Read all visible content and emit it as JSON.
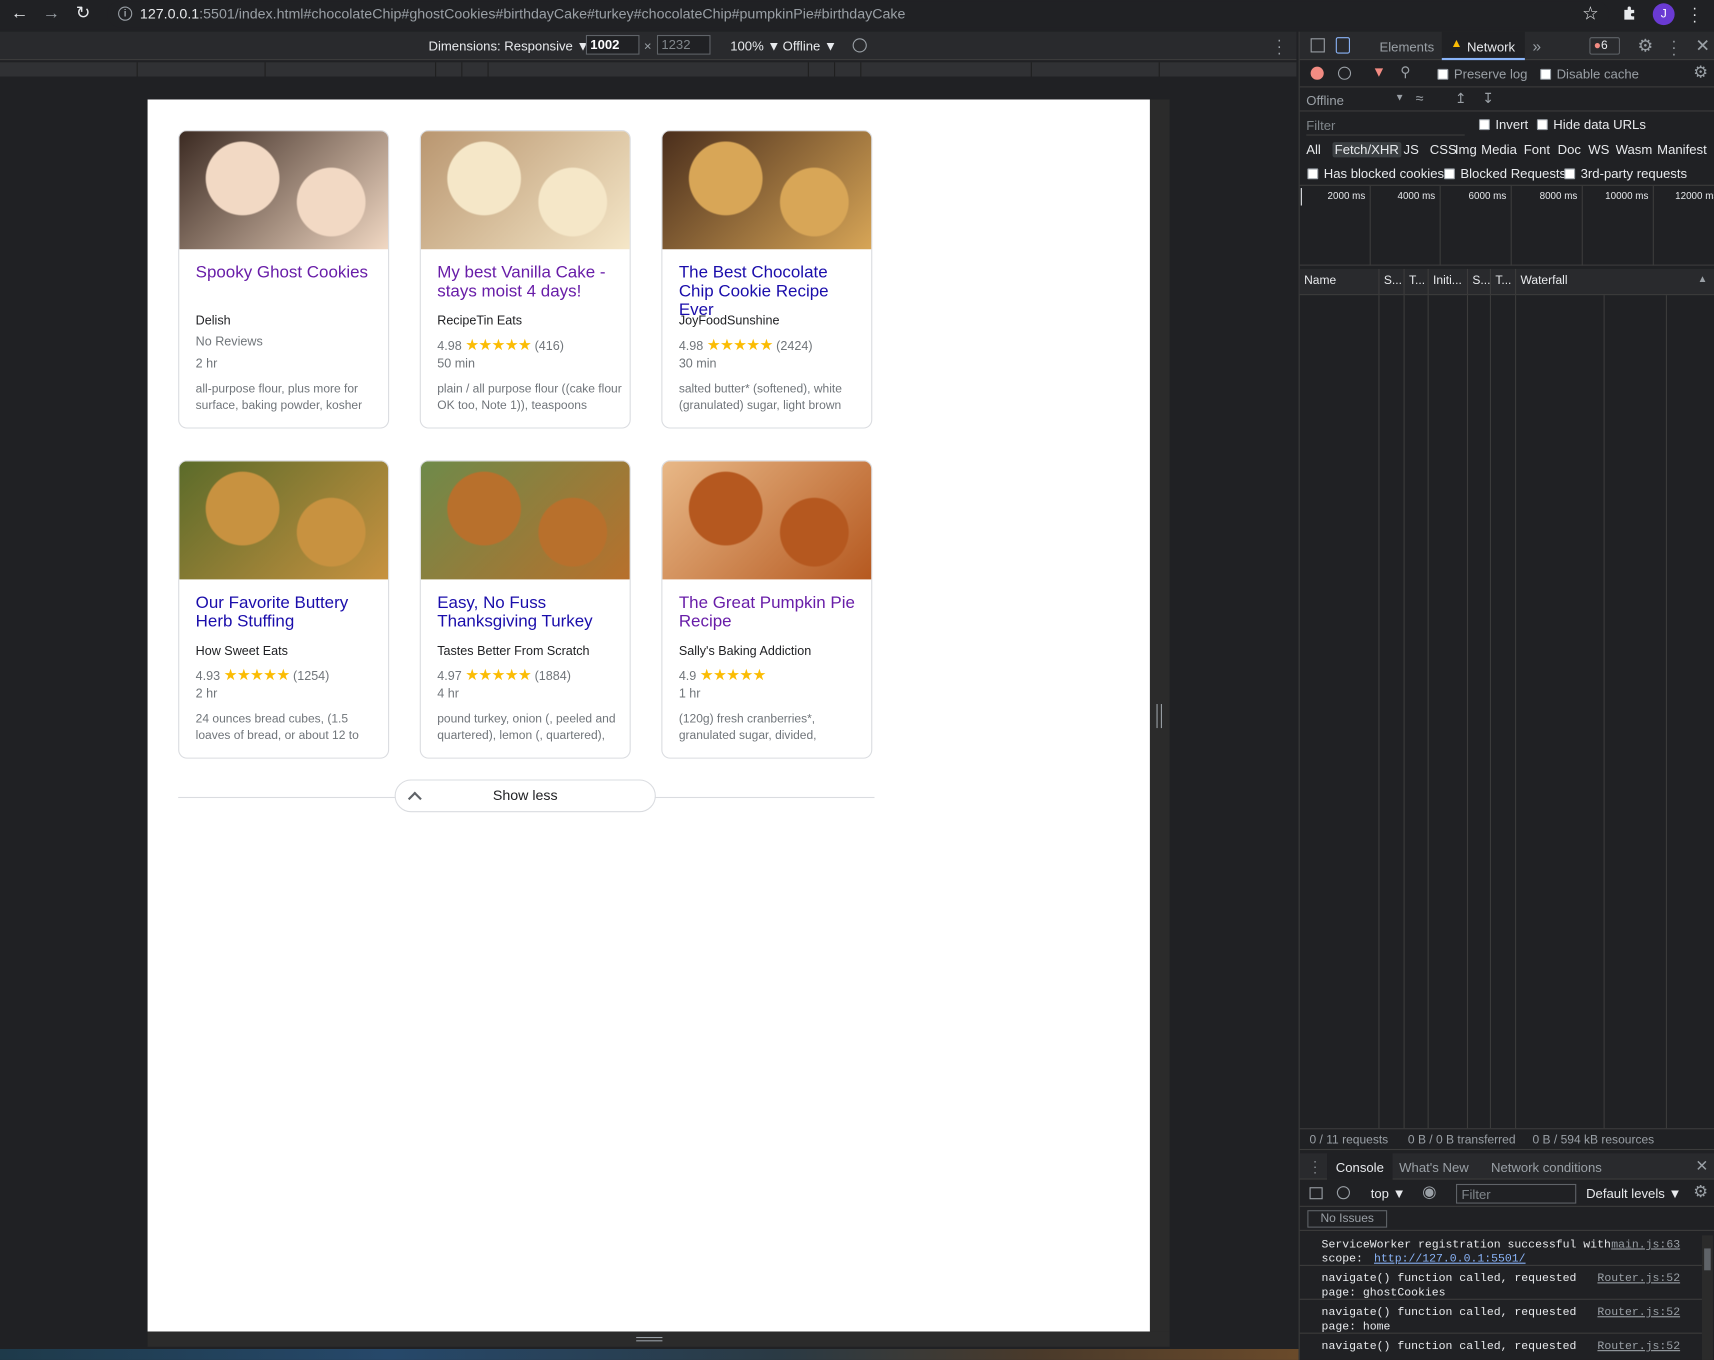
{
  "browser": {
    "url_host": "127.0.0.1",
    "url_rest": ":5501/index.html#chocolateChip#ghostCookies#birthdayCake#turkey#chocolateChip#pumpkinPie#birthdayCake",
    "avatar_letter": "J"
  },
  "device_toolbar": {
    "dimensions_label": "Dimensions: Responsive ▼",
    "width": "1002",
    "x": "×",
    "height": "1232",
    "zoom": "100% ▼",
    "throttle": "Offline ▼"
  },
  "recipes": [
    {
      "title": "Spooky Ghost Cookies",
      "visited": true,
      "source": "Delish",
      "rating": "No Reviews",
      "has_stars": false,
      "stars": "",
      "count": "",
      "time": "2 hr",
      "ingredients": "all-purpose flour, plus more for surface, baking powder, kosher",
      "img_colors": [
        "#f2d9c4",
        "#3b2a22"
      ]
    },
    {
      "title": "My best Vanilla Cake - stays moist 4 days!",
      "visited": true,
      "source": "RecipeTin Eats",
      "rating": "4.98",
      "has_stars": true,
      "stars": "★★★★★",
      "count": "(416)",
      "time": "50 min",
      "ingredients": "plain / all purpose flour ((cake flour OK too, Note 1)), teaspoons",
      "img_colors": [
        "#f5e7c8",
        "#b99670"
      ]
    },
    {
      "title": "The Best Chocolate Chip Cookie Recipe Ever",
      "visited": false,
      "source": "JoyFoodSunshine",
      "rating": "4.98",
      "has_stars": true,
      "stars": "★★★★★",
      "count": "(2424)",
      "time": "30 min",
      "ingredients": "salted butter* (softened), white (granulated) sugar, light brown",
      "img_colors": [
        "#d8a657",
        "#4a2e1c"
      ]
    },
    {
      "title": "Our Favorite Buttery Herb Stuffing",
      "visited": false,
      "source": "How Sweet Eats",
      "rating": "4.93",
      "has_stars": true,
      "stars": "★★★★★",
      "count": "(1254)",
      "time": "2 hr",
      "ingredients": "24 ounces bread cubes, (1.5 loaves of bread, or about 12 to",
      "img_colors": [
        "#c89240",
        "#5b6b2a"
      ]
    },
    {
      "title": "Easy, No Fuss Thanksgiving Turkey",
      "visited": false,
      "source": "Tastes Better From Scratch",
      "rating": "4.97",
      "has_stars": true,
      "stars": "★★★★★",
      "count": "(1884)",
      "time": "4 hr",
      "ingredients": "pound turkey, onion (, peeled and quartered), lemon (, quartered),",
      "img_colors": [
        "#b8702c",
        "#6e8a4a"
      ]
    },
    {
      "title": "The Great Pumpkin Pie Recipe",
      "visited": true,
      "source": "Sally's Baking Addiction",
      "rating": "4.9",
      "has_stars": true,
      "stars": "★★★★★",
      "count": "",
      "time": "1 hr",
      "ingredients": "(120g) fresh cranberries*, granulated sugar, divided,",
      "img_colors": [
        "#b5581f",
        "#e8b887"
      ]
    }
  ],
  "show_less": "Show less",
  "devtools": {
    "tabs": [
      "Elements",
      "Network"
    ],
    "more": "»",
    "error_count": "6",
    "preserve_log": "Preserve log",
    "disable_cache": "Disable cache",
    "throttle": "Offline",
    "filter_placeholder": "Filter",
    "invert": "Invert",
    "hide_data_urls": "Hide data URLs",
    "types": [
      "All",
      "Fetch/XHR",
      "JS",
      "CSS",
      "Img",
      "Media",
      "Font",
      "Doc",
      "WS",
      "Wasm",
      "Manifest"
    ],
    "has_blocked_cookies": "Has blocked cookies",
    "blocked_requests": "Blocked Requests",
    "third_party": "3rd-party requests",
    "timeline": [
      "2000 ms",
      "4000 ms",
      "6000 ms",
      "8000 ms",
      "10000 ms",
      "12000 ms"
    ],
    "columns": [
      "Name",
      "S...",
      "T...",
      "Initi...",
      "S...",
      "T...",
      "Waterfall"
    ],
    "status_requests": "0 / 11 requests",
    "status_transferred": "0 B / 0 B transferred",
    "status_resources": "0 B / 594 kB resources",
    "drawer_tabs": [
      "Console",
      "What's New",
      "Network conditions"
    ],
    "context": "top ▼",
    "console_filter": "Filter",
    "levels": "Default levels ▼",
    "no_issues": "No Issues",
    "logs": [
      {
        "text": "ServiceWorker registration successful with\nscope:  ",
        "link": "main.js:63",
        "link2": "http://127.0.0.1:5501/"
      },
      {
        "text": "navigate() function called, requested\npage: ghostCookies",
        "link": "Router.js:52",
        "link2": ""
      },
      {
        "text": "navigate() function called, requested\npage: home",
        "link": "Router.js:52",
        "link2": ""
      },
      {
        "text": "navigate() function called, requested",
        "link": "Router.js:52",
        "link2": ""
      }
    ]
  }
}
